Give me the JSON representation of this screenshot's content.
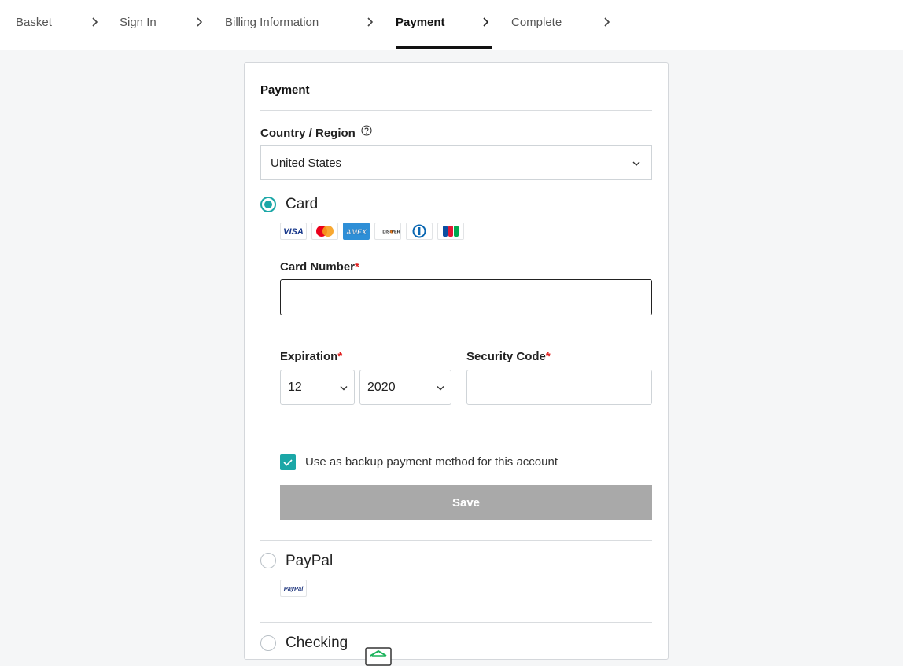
{
  "breadcrumbs": [
    {
      "label": "Basket",
      "active": false
    },
    {
      "label": "Sign In",
      "active": false
    },
    {
      "label": "Billing Information",
      "active": false
    },
    {
      "label": "Payment",
      "active": true
    },
    {
      "label": "Complete",
      "active": false
    }
  ],
  "payment": {
    "title": "Payment",
    "country_label": "Country / Region",
    "country_value": "United States",
    "methods": {
      "card": {
        "label": "Card",
        "selected": true,
        "brands": [
          "VISA",
          "Mastercard",
          "AMEX",
          "DISCOVER",
          "Diners Club",
          "JCB"
        ],
        "card_number_label": "Card Number",
        "card_number_value": "",
        "expiration_label": "Expiration",
        "exp_month": "12",
        "exp_year": "2020",
        "security_code_label": "Security Code",
        "security_code_value": "",
        "required_mark": "*",
        "backup_checkbox_label": "Use as backup payment method for this account",
        "backup_checked": true,
        "save_label": "Save"
      },
      "paypal": {
        "label": "PayPal",
        "selected": false,
        "logo_text": "PayPal"
      },
      "checking": {
        "label": "Checking",
        "selected": false
      }
    }
  },
  "colors": {
    "accent": "#1ba7a7",
    "required": "#e02020",
    "save_disabled": "#a9a9a9"
  }
}
